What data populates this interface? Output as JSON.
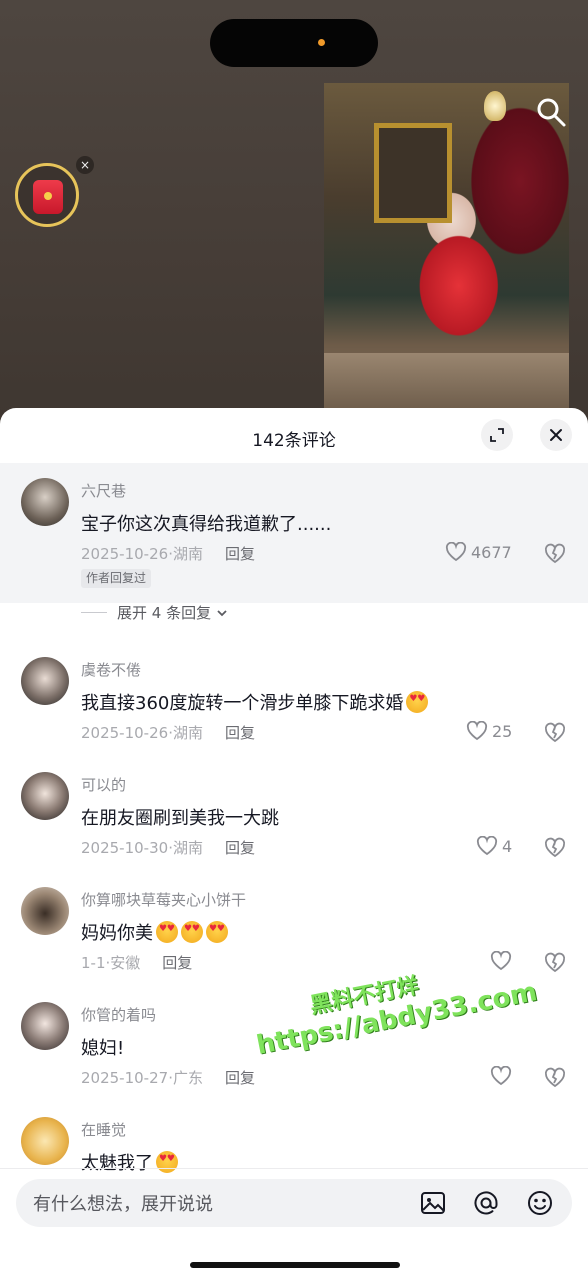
{
  "sheet": {
    "title": "142条评论"
  },
  "comments": [
    {
      "user": "六尺巷",
      "text": "宝子你这次真得给我道歉了......",
      "date": "2025-10-26",
      "location": "湖南",
      "reply_label": "回复",
      "likes": "4677",
      "tag": "作者回复过",
      "expand": "展开 4 条回复"
    },
    {
      "user": "虞卷不倦",
      "text": "我直接360度旋转一个滑步单膝下跪求婚",
      "date": "2025-10-26",
      "location": "湖南",
      "reply_label": "回复",
      "likes": "25"
    },
    {
      "user": "可以的",
      "text": "在朋友圈刷到美我一大跳",
      "date": "2025-10-30",
      "location": "湖南",
      "reply_label": "回复",
      "likes": "4"
    },
    {
      "user": "你算哪块草莓夹心小饼干",
      "text": "妈妈你美",
      "date": "1-1",
      "location": "安徽",
      "reply_label": "回复",
      "likes": ""
    },
    {
      "user": "你管的着吗",
      "text": "媳妇!",
      "date": "2025-10-27",
      "location": "广东",
      "reply_label": "回复",
      "likes": ""
    },
    {
      "user": "在睡觉",
      "text": "太魅我了",
      "date": "",
      "location": "",
      "reply_label": "",
      "likes": ""
    }
  ],
  "input": {
    "placeholder": "有什么想法，展开说说"
  },
  "watermark": {
    "line1": "黑料不打烊",
    "line2": "https://abdy33.com"
  },
  "colors": {
    "text": "#161823",
    "meta": "#a8a9ae",
    "accent_watermark": "#7fe35c"
  },
  "icons": [
    "search-icon",
    "red-packet-icon",
    "close-icon",
    "fullscreen-icon",
    "heart-icon",
    "broken-heart-icon",
    "chevron-down-icon",
    "image-icon",
    "at-icon",
    "emoji-icon"
  ]
}
